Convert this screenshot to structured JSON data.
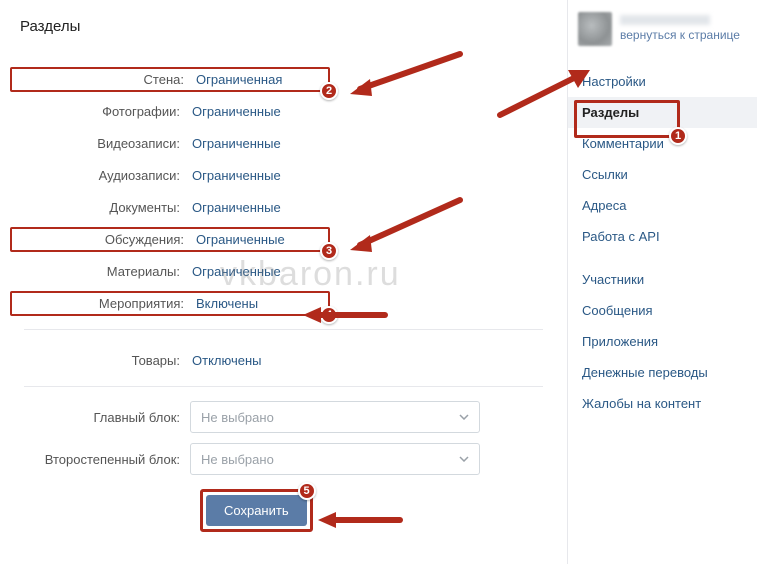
{
  "page_title": "Разделы",
  "settings": {
    "wall": {
      "label": "Стена:",
      "value": "Ограниченная"
    },
    "photos": {
      "label": "Фотографии:",
      "value": "Ограниченные"
    },
    "videos": {
      "label": "Видеозаписи:",
      "value": "Ограниченные"
    },
    "audios": {
      "label": "Аудиозаписи:",
      "value": "Ограниченные"
    },
    "docs": {
      "label": "Документы:",
      "value": "Ограниченные"
    },
    "discussions": {
      "label": "Обсуждения:",
      "value": "Ограниченные"
    },
    "materials": {
      "label": "Материалы:",
      "value": "Ограниченные"
    },
    "events": {
      "label": "Мероприятия:",
      "value": "Включены"
    },
    "goods": {
      "label": "Товары:",
      "value": "Отключены"
    }
  },
  "blocks": {
    "main": {
      "label": "Главный блок:",
      "placeholder": "Не выбрано"
    },
    "secondary": {
      "label": "Второстепенный блок:",
      "placeholder": "Не выбрано"
    }
  },
  "save_label": "Сохранить",
  "profile": {
    "back_link": "вернуться к странице"
  },
  "sidebar": {
    "items": [
      {
        "label": "Настройки",
        "active": false
      },
      {
        "label": "Разделы",
        "active": true
      },
      {
        "label": "Комментарии",
        "active": false
      },
      {
        "label": "Ссылки",
        "active": false
      },
      {
        "label": "Адреса",
        "active": false
      },
      {
        "label": "Работа с API",
        "active": false
      }
    ],
    "items_group2": [
      {
        "label": "Участники"
      },
      {
        "label": "Сообщения"
      },
      {
        "label": "Приложения"
      },
      {
        "label": "Денежные переводы"
      },
      {
        "label": "Жалобы на контент"
      }
    ]
  },
  "annotations": {
    "badges": {
      "1": "1",
      "2": "2",
      "3": "3",
      "4": "4",
      "5": "5"
    }
  },
  "watermark": "vkbaron.ru"
}
